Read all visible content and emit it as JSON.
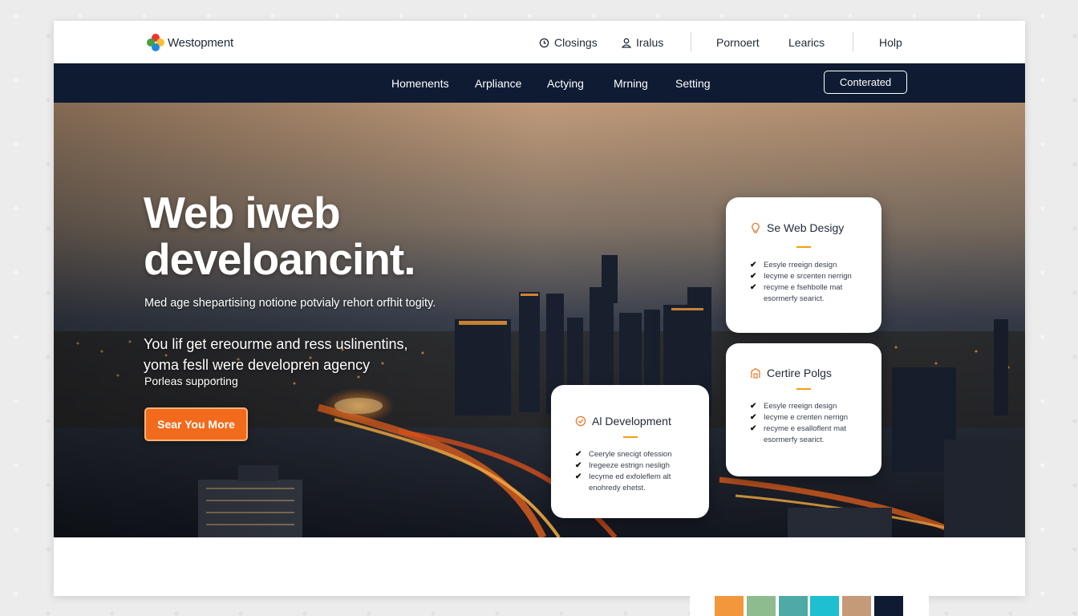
{
  "brand": {
    "name": "Westopment"
  },
  "topbar": {
    "utility": [
      {
        "label": "Closings",
        "icon": "clock-icon"
      },
      {
        "label": "Iralus",
        "icon": "user-icon"
      },
      {
        "label": "Pornoert"
      },
      {
        "label": "Learics"
      },
      {
        "label": "Holp"
      }
    ]
  },
  "nav": {
    "items": [
      "Homenents",
      "Arpliance",
      "Actying",
      "Mrning",
      "Setting"
    ],
    "cta_label": "Conterated"
  },
  "hero": {
    "title_line1": "Web iweb",
    "title_line2": "develoancint.",
    "subtitle": "Med age shepartising notione potvialy rehort orfhit togity.",
    "body_line1": "You lif get ereourme and ress uslinentins,",
    "body_line2": "yoma fesll were developren agency",
    "small": "Porleas supporting",
    "button_label": "Sear You More"
  },
  "cards": [
    {
      "title": "Se Web Desigy",
      "icon": "lightbulb-icon",
      "items": [
        {
          "text": "Eesyle rreeign design",
          "checked": true
        },
        {
          "text": "Iecyme e srcenten nerrign",
          "checked": true
        },
        {
          "text": "recyme e fsehbolle mat",
          "checked": true
        },
        {
          "text": "esormerfy searict.",
          "checked": false
        }
      ]
    },
    {
      "title": "Certire Polgs",
      "icon": "building-icon",
      "items": [
        {
          "text": "Eesyle rreeign design",
          "checked": true
        },
        {
          "text": "Iecyme e crenten nerrign",
          "checked": true
        },
        {
          "text": "recyme e esalloflent mat",
          "checked": true
        },
        {
          "text": "esormerfy searict.",
          "checked": false
        }
      ]
    },
    {
      "title": "Al Development",
      "icon": "check-badge-icon",
      "items": [
        {
          "text": "Ceeryle snecigt ofession",
          "checked": true
        },
        {
          "text": "Iregeeze estrign nesligh",
          "checked": true
        },
        {
          "text": "Iecyme ed exfoleflem alt",
          "checked": true
        },
        {
          "text": "enohredy ehetst.",
          "checked": false
        }
      ]
    }
  ],
  "colors": {
    "navy": "#0e1b33",
    "accent": "#f26a1b",
    "swatches": [
      "#f3973d",
      "#8fbc8f",
      "#4fa9a5",
      "#1ebfd0",
      "#c49a78",
      "#0e1b33"
    ]
  }
}
